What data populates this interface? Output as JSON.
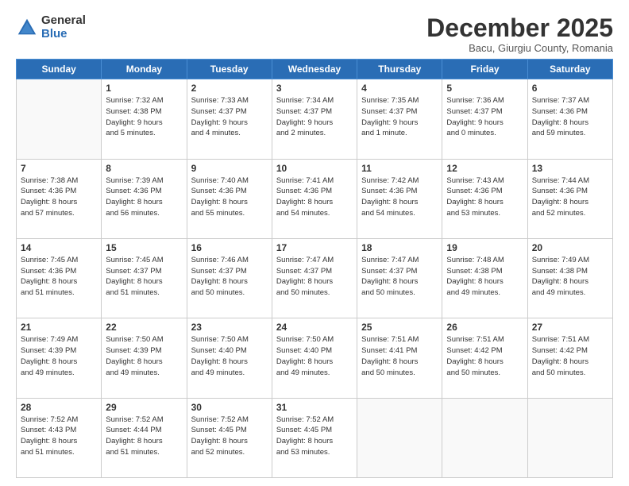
{
  "logo": {
    "general": "General",
    "blue": "Blue"
  },
  "header": {
    "month": "December 2025",
    "location": "Bacu, Giurgiu County, Romania"
  },
  "weekdays": [
    "Sunday",
    "Monday",
    "Tuesday",
    "Wednesday",
    "Thursday",
    "Friday",
    "Saturday"
  ],
  "weeks": [
    [
      {
        "day": "",
        "detail": ""
      },
      {
        "day": "1",
        "detail": "Sunrise: 7:32 AM\nSunset: 4:38 PM\nDaylight: 9 hours\nand 5 minutes."
      },
      {
        "day": "2",
        "detail": "Sunrise: 7:33 AM\nSunset: 4:37 PM\nDaylight: 9 hours\nand 4 minutes."
      },
      {
        "day": "3",
        "detail": "Sunrise: 7:34 AM\nSunset: 4:37 PM\nDaylight: 9 hours\nand 2 minutes."
      },
      {
        "day": "4",
        "detail": "Sunrise: 7:35 AM\nSunset: 4:37 PM\nDaylight: 9 hours\nand 1 minute."
      },
      {
        "day": "5",
        "detail": "Sunrise: 7:36 AM\nSunset: 4:37 PM\nDaylight: 9 hours\nand 0 minutes."
      },
      {
        "day": "6",
        "detail": "Sunrise: 7:37 AM\nSunset: 4:36 PM\nDaylight: 8 hours\nand 59 minutes."
      }
    ],
    [
      {
        "day": "7",
        "detail": "Sunrise: 7:38 AM\nSunset: 4:36 PM\nDaylight: 8 hours\nand 57 minutes."
      },
      {
        "day": "8",
        "detail": "Sunrise: 7:39 AM\nSunset: 4:36 PM\nDaylight: 8 hours\nand 56 minutes."
      },
      {
        "day": "9",
        "detail": "Sunrise: 7:40 AM\nSunset: 4:36 PM\nDaylight: 8 hours\nand 55 minutes."
      },
      {
        "day": "10",
        "detail": "Sunrise: 7:41 AM\nSunset: 4:36 PM\nDaylight: 8 hours\nand 54 minutes."
      },
      {
        "day": "11",
        "detail": "Sunrise: 7:42 AM\nSunset: 4:36 PM\nDaylight: 8 hours\nand 54 minutes."
      },
      {
        "day": "12",
        "detail": "Sunrise: 7:43 AM\nSunset: 4:36 PM\nDaylight: 8 hours\nand 53 minutes."
      },
      {
        "day": "13",
        "detail": "Sunrise: 7:44 AM\nSunset: 4:36 PM\nDaylight: 8 hours\nand 52 minutes."
      }
    ],
    [
      {
        "day": "14",
        "detail": "Sunrise: 7:45 AM\nSunset: 4:36 PM\nDaylight: 8 hours\nand 51 minutes."
      },
      {
        "day": "15",
        "detail": "Sunrise: 7:45 AM\nSunset: 4:37 PM\nDaylight: 8 hours\nand 51 minutes."
      },
      {
        "day": "16",
        "detail": "Sunrise: 7:46 AM\nSunset: 4:37 PM\nDaylight: 8 hours\nand 50 minutes."
      },
      {
        "day": "17",
        "detail": "Sunrise: 7:47 AM\nSunset: 4:37 PM\nDaylight: 8 hours\nand 50 minutes."
      },
      {
        "day": "18",
        "detail": "Sunrise: 7:47 AM\nSunset: 4:37 PM\nDaylight: 8 hours\nand 50 minutes."
      },
      {
        "day": "19",
        "detail": "Sunrise: 7:48 AM\nSunset: 4:38 PM\nDaylight: 8 hours\nand 49 minutes."
      },
      {
        "day": "20",
        "detail": "Sunrise: 7:49 AM\nSunset: 4:38 PM\nDaylight: 8 hours\nand 49 minutes."
      }
    ],
    [
      {
        "day": "21",
        "detail": "Sunrise: 7:49 AM\nSunset: 4:39 PM\nDaylight: 8 hours\nand 49 minutes."
      },
      {
        "day": "22",
        "detail": "Sunrise: 7:50 AM\nSunset: 4:39 PM\nDaylight: 8 hours\nand 49 minutes."
      },
      {
        "day": "23",
        "detail": "Sunrise: 7:50 AM\nSunset: 4:40 PM\nDaylight: 8 hours\nand 49 minutes."
      },
      {
        "day": "24",
        "detail": "Sunrise: 7:50 AM\nSunset: 4:40 PM\nDaylight: 8 hours\nand 49 minutes."
      },
      {
        "day": "25",
        "detail": "Sunrise: 7:51 AM\nSunset: 4:41 PM\nDaylight: 8 hours\nand 50 minutes."
      },
      {
        "day": "26",
        "detail": "Sunrise: 7:51 AM\nSunset: 4:42 PM\nDaylight: 8 hours\nand 50 minutes."
      },
      {
        "day": "27",
        "detail": "Sunrise: 7:51 AM\nSunset: 4:42 PM\nDaylight: 8 hours\nand 50 minutes."
      }
    ],
    [
      {
        "day": "28",
        "detail": "Sunrise: 7:52 AM\nSunset: 4:43 PM\nDaylight: 8 hours\nand 51 minutes."
      },
      {
        "day": "29",
        "detail": "Sunrise: 7:52 AM\nSunset: 4:44 PM\nDaylight: 8 hours\nand 51 minutes."
      },
      {
        "day": "30",
        "detail": "Sunrise: 7:52 AM\nSunset: 4:45 PM\nDaylight: 8 hours\nand 52 minutes."
      },
      {
        "day": "31",
        "detail": "Sunrise: 7:52 AM\nSunset: 4:45 PM\nDaylight: 8 hours\nand 53 minutes."
      },
      {
        "day": "",
        "detail": ""
      },
      {
        "day": "",
        "detail": ""
      },
      {
        "day": "",
        "detail": ""
      }
    ]
  ]
}
